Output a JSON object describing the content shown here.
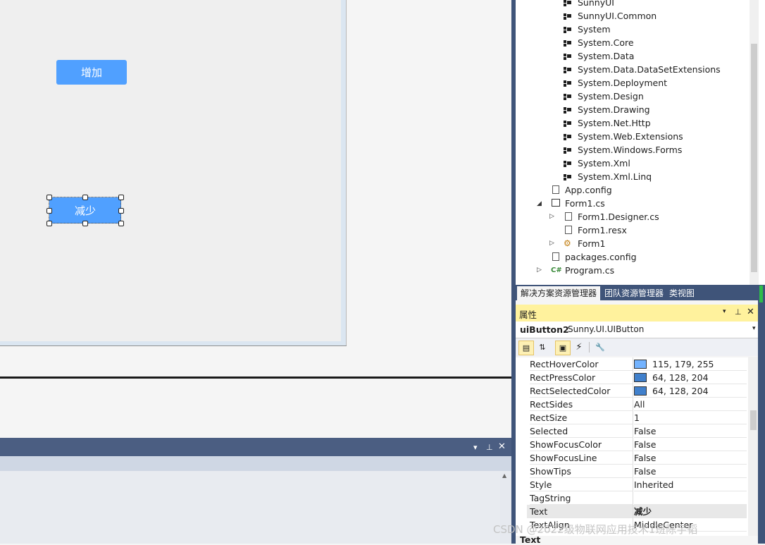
{
  "designer": {
    "add_button_label": "增加",
    "subtract_button_label": "减少"
  },
  "colors": {
    "button_fill": "#50a0ff",
    "rect_hover": "#73b3ff",
    "rect_press": "#4080cc",
    "rect_selected": "#4080cc",
    "properties_title_bg": "#fff29d",
    "chrome_dark": "#3f5479"
  },
  "output_panel": {
    "icons": [
      "dropdown-icon",
      "pin-icon",
      "close-icon"
    ]
  },
  "solution_explorer": {
    "references": [
      "SunnyUI",
      "SunnyUI.Common",
      "System",
      "System.Core",
      "System.Data",
      "System.Data.DataSetExtensions",
      "System.Deployment",
      "System.Design",
      "System.Drawing",
      "System.Net.Http",
      "System.Web.Extensions",
      "System.Windows.Forms",
      "System.Xml",
      "System.Xml.Linq"
    ],
    "files": {
      "app_config": "App.config",
      "form1_cs": "Form1.cs",
      "form1_designer": "Form1.Designer.cs",
      "form1_resx": "Form1.resx",
      "form1_class": "Form1",
      "packages_config": "packages.config",
      "program_cs": "Program.cs"
    },
    "tabs": [
      "解决方案资源管理器",
      "团队资源管理器",
      "类视图"
    ]
  },
  "properties": {
    "title": "属性",
    "object_name": "uiButton2",
    "object_type": "Sunny.UI.UIButton",
    "rows": [
      {
        "name": "RectHoverColor",
        "value": "115, 179, 255",
        "swatch": "#73b3ff"
      },
      {
        "name": "RectPressColor",
        "value": "64, 128, 204",
        "swatch": "#4080cc"
      },
      {
        "name": "RectSelectedColor",
        "value": "64, 128, 204",
        "swatch": "#4080cc"
      },
      {
        "name": "RectSides",
        "value": "All"
      },
      {
        "name": "RectSize",
        "value": "1"
      },
      {
        "name": "Selected",
        "value": "False"
      },
      {
        "name": "ShowFocusColor",
        "value": "False"
      },
      {
        "name": "ShowFocusLine",
        "value": "False"
      },
      {
        "name": "ShowTips",
        "value": "False"
      },
      {
        "name": "Style",
        "value": "Inherited"
      },
      {
        "name": "TagString",
        "value": ""
      },
      {
        "name": "Text",
        "value": "减少"
      },
      {
        "name": "TextAlign",
        "value": "MiddleCenter"
      }
    ],
    "description_title": "Text"
  },
  "watermark": "CSDN @2022级物联网应用技术1班陈宇韬"
}
